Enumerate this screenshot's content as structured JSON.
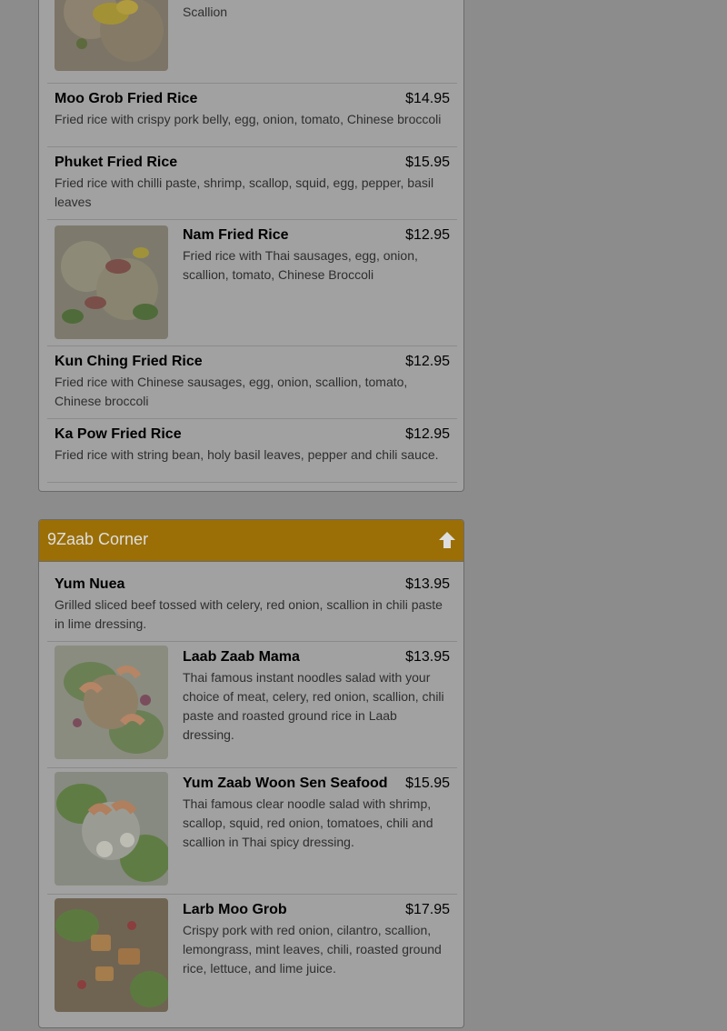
{
  "colors": {
    "overlay_bg": "#8c8c8c",
    "panel_bg": "#a1a1a1",
    "heading_bg": "#9b6f06",
    "heading_text": "#dedede"
  },
  "fried_rice": {
    "first_item_desc_tail": "Scallion",
    "items": [
      {
        "name": "Moo Grob Fried Rice",
        "price": "$14.95",
        "desc": "Fried rice with crispy pork belly, egg, onion, tomato, Chinese broccoli"
      },
      {
        "name": "Phuket Fried Rice",
        "price": "$15.95",
        "desc": "Fried rice with chilli paste, shrimp, scallop, squid, egg, pepper, basil leaves"
      },
      {
        "name": "Nam Fried Rice",
        "price": "$12.95",
        "desc": "Fried rice with Thai sausages, egg, onion, scallion, tomato, Chinese Broccoli"
      },
      {
        "name": "Kun Ching Fried Rice",
        "price": "$12.95",
        "desc": "Fried rice with Chinese sausages, egg, onion, scallion, tomato, Chinese broccoli"
      },
      {
        "name": "Ka Pow Fried Rice",
        "price": "$12.95",
        "desc": "Fried rice with string bean, holy basil leaves, pepper and chili sauce."
      }
    ]
  },
  "section": {
    "title": "9Zaab Corner",
    "up_icon": "arrow-up-icon",
    "items": [
      {
        "name": "Yum Nuea",
        "price": "$13.95",
        "desc": "Grilled sliced beef tossed with celery, red onion, scallion in chili paste in lime dressing."
      },
      {
        "name": "Laab Zaab Mama",
        "price": "$13.95",
        "desc": "Thai famous instant noodles salad with your choice of meat, celery, red onion, scallion, chili paste and roasted ground rice in Laab dressing."
      },
      {
        "name": "Yum Zaab Woon Sen Seafood",
        "price": "$15.95",
        "desc": "Thai famous clear noodle salad with shrimp, scallop, squid, red onion, tomatoes, chili and scallion in Thai spicy dressing."
      },
      {
        "name": "Larb Moo Grob",
        "price": "$17.95",
        "desc": "Crispy pork with red onion, cilantro, scallion, lemongrass, mint leaves, chili, roasted ground rice, lettuce, and lime juice."
      }
    ]
  }
}
